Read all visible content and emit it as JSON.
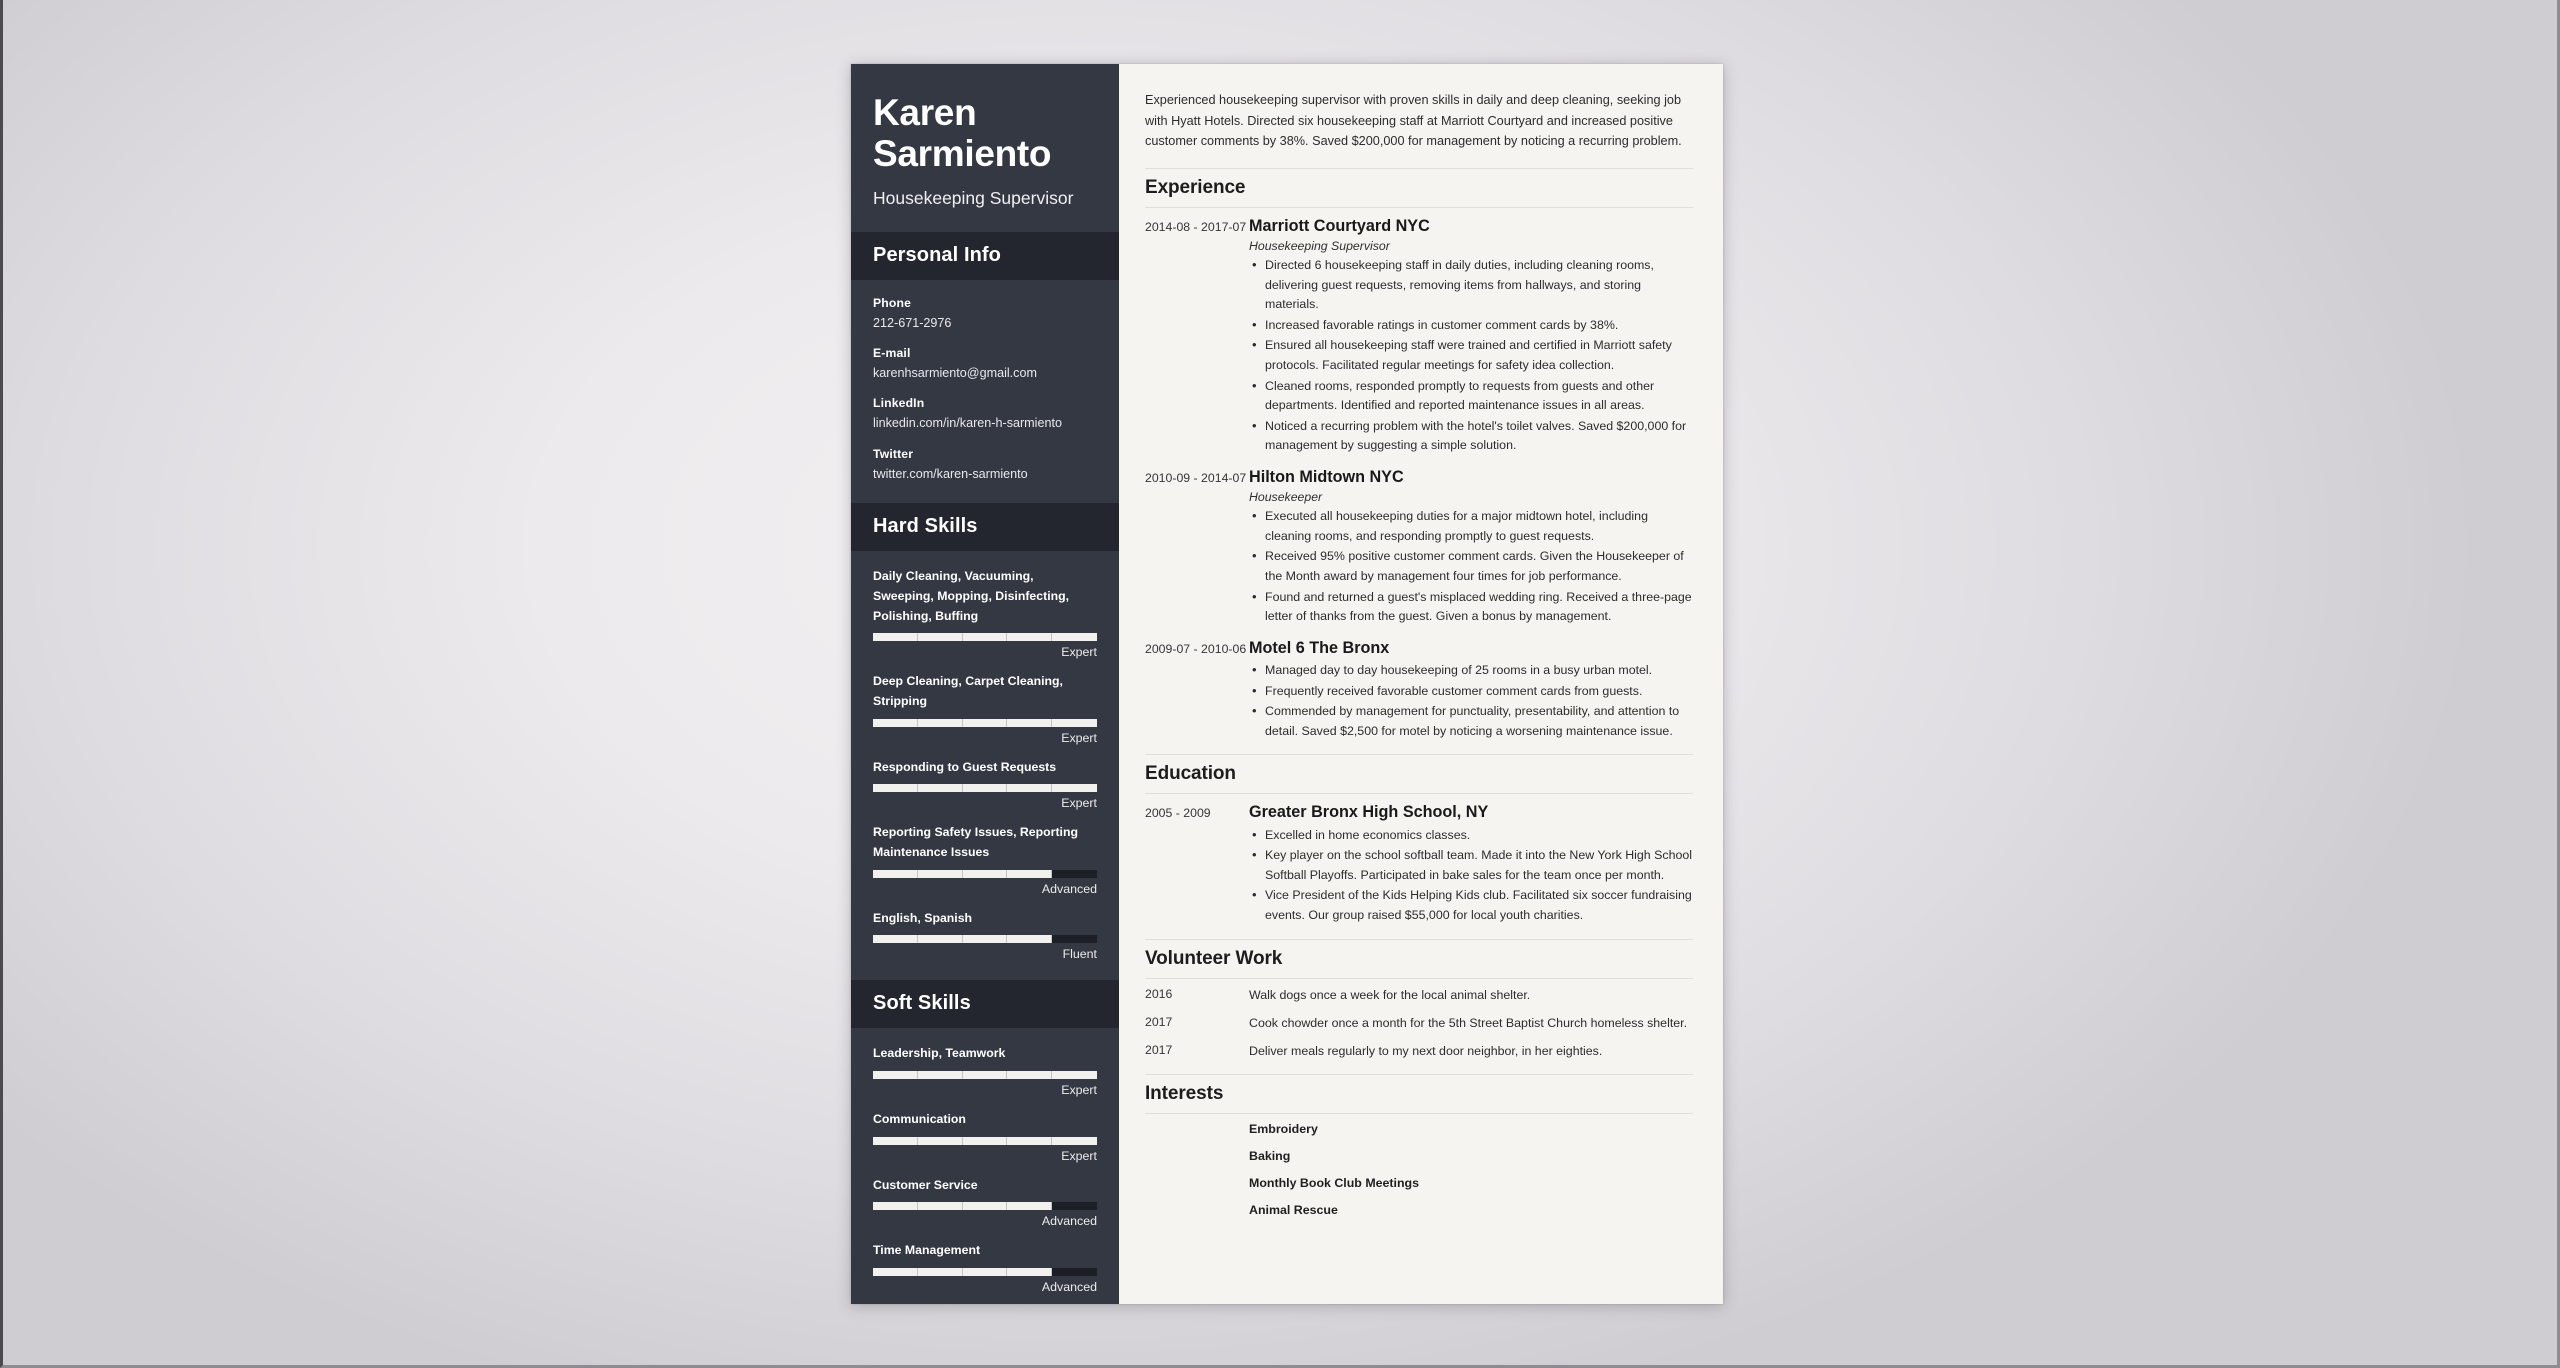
{
  "document": {
    "type": "resume",
    "page_background": "#f5f4f0",
    "sidebar_background": "#343842",
    "sidebar_heading_background": "#23262e"
  },
  "sidebar": {
    "name": "Karen Sarmiento",
    "job_title": "Housekeeping Supervisor",
    "personal_info": {
      "heading": "Personal Info",
      "items": [
        {
          "label": "Phone",
          "value": "212-671-2976"
        },
        {
          "label": "E-mail",
          "value": "karenhsarmiento@gmail.com"
        },
        {
          "label": "LinkedIn",
          "value": "linkedin.com/in/karen-h-sarmiento"
        },
        {
          "label": "Twitter",
          "value": "twitter.com/karen-sarmiento"
        }
      ]
    },
    "hard_skills": {
      "heading": "Hard Skills",
      "items": [
        {
          "name": "Daily Cleaning, Vacuuming, Sweeping, Mopping, Disinfecting, Polishing, Buffing",
          "level": "Expert",
          "percent": 100
        },
        {
          "name": "Deep Cleaning, Carpet Cleaning, Stripping",
          "level": "Expert",
          "percent": 100
        },
        {
          "name": "Responding to Guest Requests",
          "level": "Expert",
          "percent": 100
        },
        {
          "name": "Reporting Safety Issues, Reporting Maintenance Issues",
          "level": "Advanced",
          "percent": 80
        },
        {
          "name": "English, Spanish",
          "level": "Fluent",
          "percent": 80
        }
      ]
    },
    "soft_skills": {
      "heading": "Soft Skills",
      "items": [
        {
          "name": "Leadership, Teamwork",
          "level": "Expert",
          "percent": 100
        },
        {
          "name": "Communication",
          "level": "Expert",
          "percent": 100
        },
        {
          "name": "Customer Service",
          "level": "Advanced",
          "percent": 80
        },
        {
          "name": "Time Management",
          "level": "Advanced",
          "percent": 80
        }
      ]
    }
  },
  "main": {
    "summary": "Experienced housekeeping supervisor with proven skills in daily and deep cleaning, seeking job with Hyatt Hotels. Directed six housekeeping staff at Marriott Courtyard and increased positive customer comments by 38%. Saved $200,000 for management by noticing a recurring problem.",
    "experience": {
      "heading": "Experience",
      "entries": [
        {
          "date": "2014-08 - 2017-07",
          "organization": "Marriott Courtyard NYC",
          "role": "Housekeeping Supervisor",
          "bullets": [
            "Directed 6 housekeeping staff in daily duties, including cleaning rooms, delivering guest requests, removing items from hallways, and storing materials.",
            "Increased favorable ratings in customer comment cards by 38%.",
            "Ensured all housekeeping staff were trained and certified in Marriott safety protocols. Facilitated regular meetings for safety idea collection.",
            "Cleaned rooms, responded promptly to requests from guests and other departments. Identified and reported maintenance issues in all areas.",
            "Noticed a recurring problem with the hotel's toilet valves. Saved $200,000 for management by suggesting a simple solution."
          ]
        },
        {
          "date": "2010-09 - 2014-07",
          "organization": "Hilton Midtown NYC",
          "role": "Housekeeper",
          "bullets": [
            "Executed all housekeeping duties for a major midtown hotel, including cleaning rooms, and responding promptly to guest requests.",
            "Received 95% positive customer comment cards. Given the Housekeeper of the Month award by management four times for job performance.",
            "Found and returned a guest's misplaced wedding ring. Received a three-page letter of thanks from the guest. Given a bonus by management."
          ]
        },
        {
          "date": "2009-07 - 2010-06",
          "organization": "Motel 6 The Bronx",
          "role": "",
          "bullets": [
            "Managed day to day housekeeping of 25 rooms in a busy urban motel.",
            "Frequently received favorable customer comment cards from guests.",
            "Commended by management for punctuality, presentability, and attention to detail. Saved $2,500 for motel by noticing a worsening maintenance issue."
          ]
        }
      ]
    },
    "education": {
      "heading": "Education",
      "entries": [
        {
          "date": "2005 - 2009",
          "organization": "Greater Bronx High School, NY",
          "role": "",
          "bullets": [
            "Excelled in home economics classes.",
            "Key player on the school softball team. Made it into the New York High School Softball Playoffs. Participated in bake sales for the team once per month.",
            "Vice President of the Kids Helping Kids club. Facilitated six soccer fundraising events. Our group raised $55,000 for local youth charities."
          ]
        }
      ]
    },
    "volunteer": {
      "heading": "Volunteer Work",
      "entries": [
        {
          "year": "2016",
          "text": "Walk dogs once a week for the local animal shelter."
        },
        {
          "year": "2017",
          "text": "Cook chowder once a month for the 5th Street Baptist Church homeless shelter."
        },
        {
          "year": "2017",
          "text": "Deliver meals regularly to my next door neighbor, in her eighties."
        }
      ]
    },
    "interests": {
      "heading": "Interests",
      "items": [
        "Embroidery",
        "Baking",
        "Monthly Book Club Meetings",
        "Animal Rescue"
      ]
    }
  }
}
